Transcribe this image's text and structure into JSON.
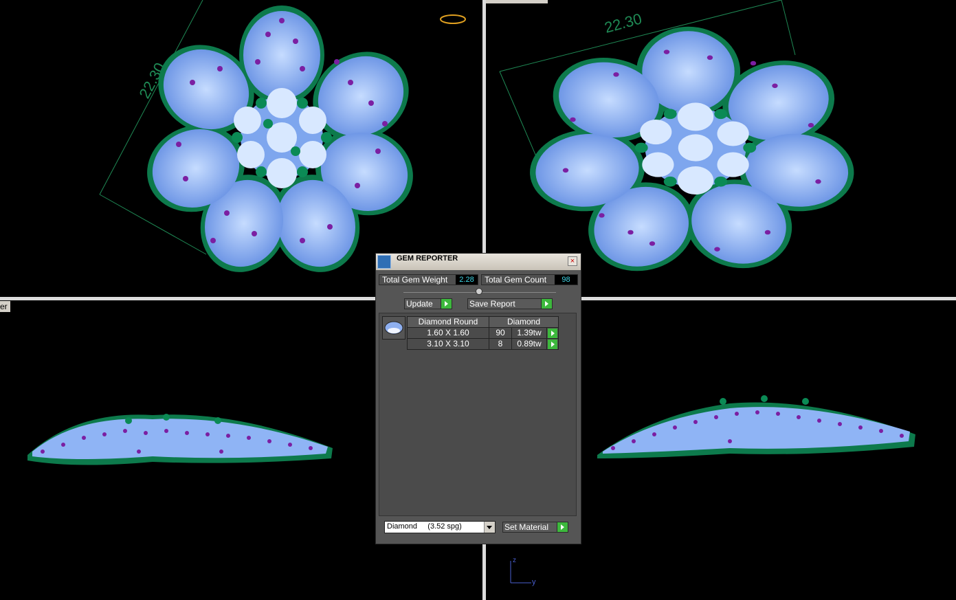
{
  "viewports": {
    "top_left": {
      "dimension": "22.30"
    },
    "top_right": {
      "dimension": "22.30"
    },
    "bottom_left": {
      "label": "er"
    }
  },
  "axis": {
    "z": "z",
    "y": "y"
  },
  "gem_reporter": {
    "title": "GEM REPORTER",
    "close_glyph": "×",
    "total_weight_label": "Total Gem Weight",
    "total_weight_value": "2.28",
    "total_count_label": "Total Gem Count",
    "total_count_value": "98",
    "update_label": "Update",
    "save_report_label": "Save Report",
    "table": {
      "headers": [
        "Diamond Round",
        "Diamond"
      ],
      "rows": [
        {
          "size": "1.60 X 1.60",
          "count": "90",
          "weight": "1.39tw"
        },
        {
          "size": "3.10 X 3.10",
          "count": "8",
          "weight": "0.89tw"
        }
      ]
    },
    "material_select": "Diamond     (3.52 spg)",
    "set_material_label": "Set Material"
  },
  "colors": {
    "gem": "#8fb4f5",
    "accent_gem": "#7b1fa2",
    "metal": "#0d7a4c",
    "dimension": "#1f8a55"
  }
}
